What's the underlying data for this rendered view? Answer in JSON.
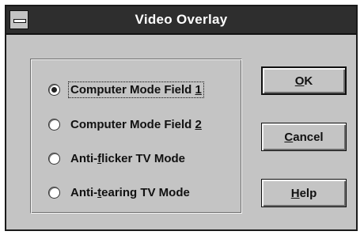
{
  "window": {
    "title": "Video Overlay"
  },
  "options": [
    {
      "pre": "Computer Mode Field ",
      "key": "1",
      "post": "",
      "selected": true
    },
    {
      "pre": "Computer Mode Field ",
      "key": "2",
      "post": "",
      "selected": false
    },
    {
      "pre": "Anti-",
      "key": "f",
      "post": "licker TV Mode",
      "selected": false
    },
    {
      "pre": "Anti-",
      "key": "t",
      "post": "earing TV Mode",
      "selected": false
    }
  ],
  "buttons": {
    "ok": {
      "key": "O",
      "rest": "K"
    },
    "cancel": {
      "key": "C",
      "rest": "ancel"
    },
    "help": {
      "key": "H",
      "rest": "elp"
    }
  }
}
